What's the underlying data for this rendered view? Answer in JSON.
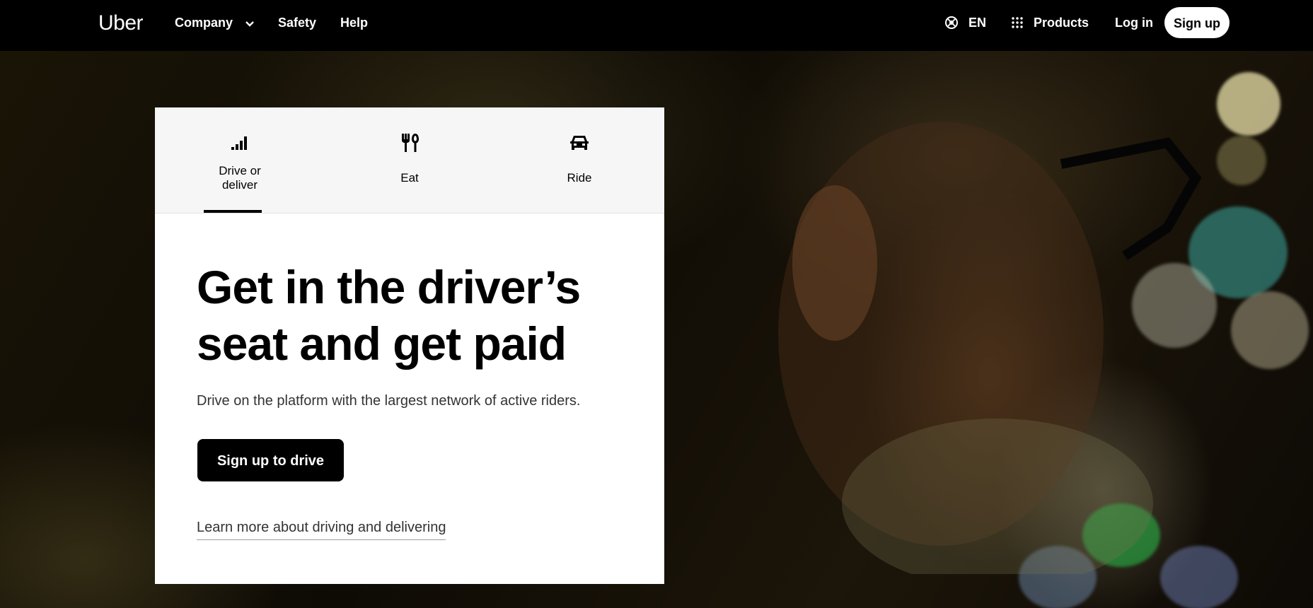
{
  "nav": {
    "brand": "Uber",
    "company_label": "Company",
    "safety_label": "Safety",
    "help_label": "Help",
    "language_label": "EN",
    "products_label": "Products",
    "login_label": "Log in",
    "signup_label": "Sign up"
  },
  "tabs": [
    {
      "label": "Drive or deliver",
      "icon": "signal-bars-icon",
      "active": true
    },
    {
      "label": "Eat",
      "icon": "fork-spoon-icon",
      "active": false
    },
    {
      "label": "Ride",
      "icon": "car-icon",
      "active": false
    }
  ],
  "hero": {
    "headline": "Get in the driver’s seat and get paid",
    "subtext": "Drive on the platform with the largest network of active riders.",
    "cta_label": "Sign up to drive",
    "learn_more_label": "Learn more about driving and delivering"
  },
  "colors": {
    "nav_background": "#000000",
    "card_background": "#ffffff",
    "tab_strip_background": "#f6f6f6",
    "cta_background": "#000000",
    "cta_text": "#ffffff"
  }
}
